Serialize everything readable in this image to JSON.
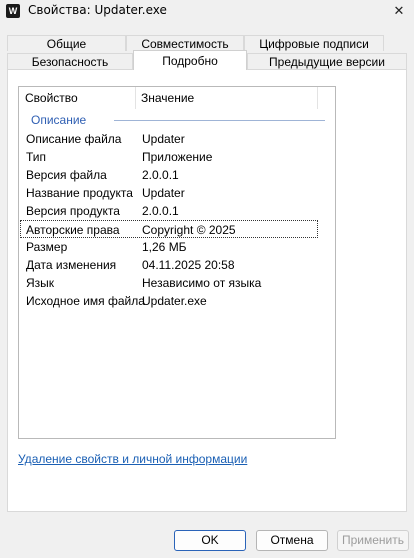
{
  "window": {
    "title": "Свойства: Updater.exe",
    "close_glyph": "✕",
    "app_icon_glyph": "W"
  },
  "tabs": {
    "row_top": [
      "Общие",
      "Совместимость",
      "Цифровые подписи"
    ],
    "row_bottom": [
      "Безопасность",
      "Подробно",
      "Предыдущие версии"
    ],
    "active": "Подробно"
  },
  "details": {
    "col_property": "Свойство",
    "col_value": "Значение",
    "group": "Описание",
    "rows": [
      {
        "prop": "Описание файла",
        "val": "Updater"
      },
      {
        "prop": "Тип",
        "val": "Приложение"
      },
      {
        "prop": "Версия файла",
        "val": "2.0.0.1"
      },
      {
        "prop": "Название продукта",
        "val": "Updater"
      },
      {
        "prop": "Версия продукта",
        "val": "2.0.0.1"
      },
      {
        "prop": "Авторские права",
        "val": "Copyright ©  2025"
      },
      {
        "prop": "Размер",
        "val": "1,26 МБ"
      },
      {
        "prop": "Дата изменения",
        "val": "04.11.2025 20:58"
      },
      {
        "prop": "Язык",
        "val": "Независимо от языка"
      },
      {
        "prop": "Исходное имя файла",
        "val": "Updater.exe"
      }
    ],
    "focused_row": "Авторские права"
  },
  "link": {
    "text": "Удаление свойств и личной информации"
  },
  "buttons": {
    "ok": "OK",
    "cancel": "Отмена",
    "apply": "Применить"
  }
}
